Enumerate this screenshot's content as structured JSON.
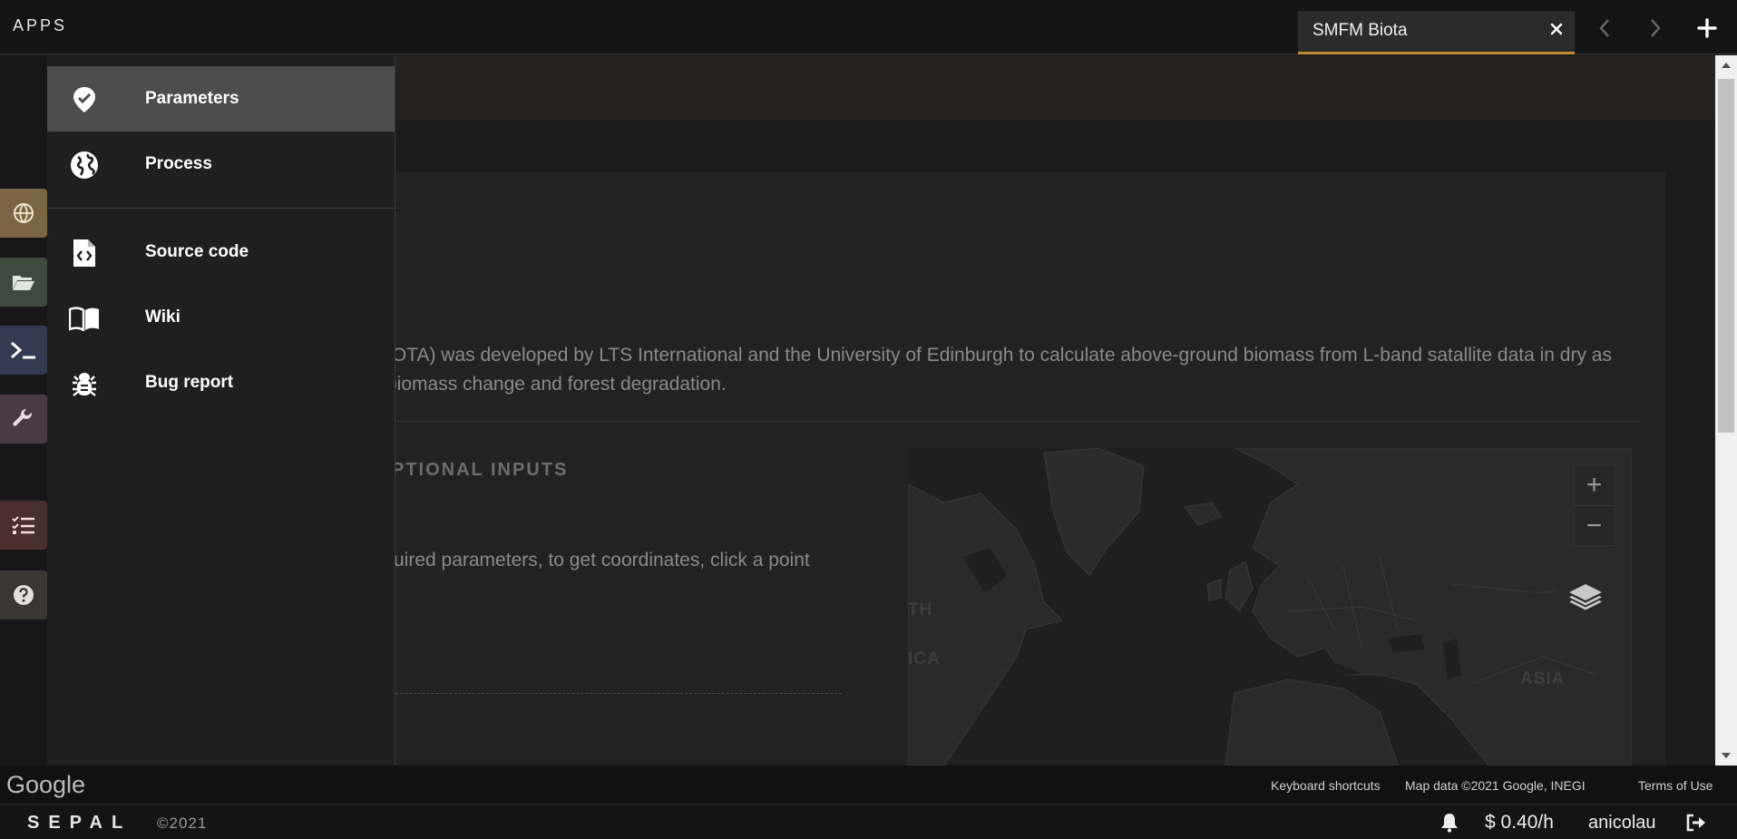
{
  "topbar": {
    "apps_label": "APPS",
    "active_tab": {
      "title": "SMFM Biota",
      "icon": "close-icon"
    },
    "nav": {
      "back_icon": "chevron-left-icon",
      "forward_icon": "chevron-right-icon",
      "add_icon": "plus-icon"
    }
  },
  "rail": {
    "items": [
      {
        "name": "process",
        "icon": "globe-icon",
        "color": "#7b6543"
      },
      {
        "name": "files",
        "icon": "folder-icon",
        "color": "#3e4a3e"
      },
      {
        "name": "terminal",
        "icon": "terminal-icon",
        "color": "#333a52"
      },
      {
        "name": "apps",
        "icon": "wrench-icon",
        "color": "#4a3a44"
      },
      {
        "name": "tasks",
        "icon": "tasks-icon",
        "color": "#4a2e2e"
      },
      {
        "name": "help",
        "icon": "help-icon",
        "color": "#3a3632"
      }
    ]
  },
  "menu": {
    "items": [
      {
        "label": "Parameters",
        "icon": "map-pin-check-icon",
        "active": true
      },
      {
        "label": "Process",
        "icon": "globe-icon",
        "active": false
      },
      {
        "label": "Source code",
        "icon": "code-file-icon",
        "active": false
      },
      {
        "label": "Wiki",
        "icon": "book-icon",
        "active": false
      },
      {
        "label": "Bug report",
        "icon": "bug-icon",
        "active": false
      }
    ]
  },
  "content": {
    "partial_title": ")",
    "about_text": "IOTA) was developed by LTS International and the University of Edinburgh to calculate above-ground biomass from L-band satallite data in dry as biomass change and forest degradation.",
    "optional_inputs_header": "PTIONAL INPUTS",
    "required_text": "uired parameters, to get coordinates, click a point"
  },
  "map": {
    "labels": {
      "north_america_1": "TH",
      "north_america_2": "ICA",
      "asia": "ASIA"
    },
    "zoom_in": "+",
    "zoom_out": "−",
    "layers_icon": "layers-icon",
    "footer": {
      "logo": "Google",
      "keyboard_shortcuts": "Keyboard shortcuts",
      "map_data": "Map data ©2021 Google, INEGI",
      "terms": "Terms of Use"
    }
  },
  "statusbar": {
    "brand": "SEPAL",
    "copyright": "©2021",
    "notification_icon": "bell-icon",
    "budget": "$ 0.40/h",
    "username": "anicolau",
    "logout_icon": "logout-icon"
  },
  "colors": {
    "tab_accent": "#c08a34",
    "active_menu_bg": "#4d4d4d"
  }
}
